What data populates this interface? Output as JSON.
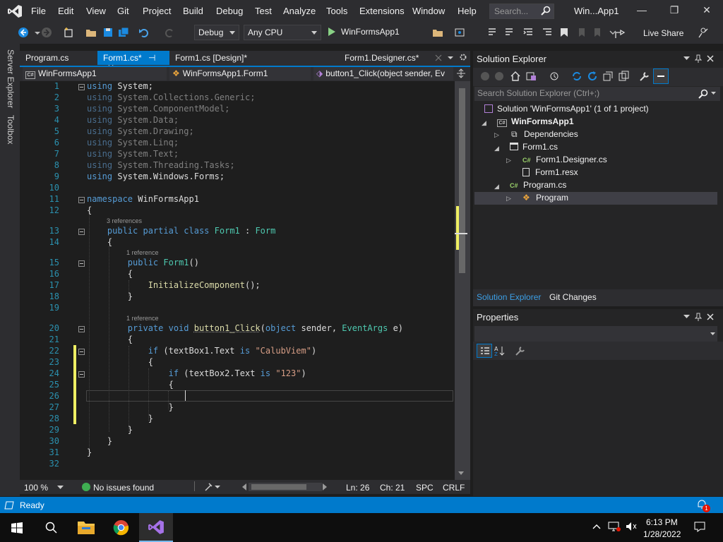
{
  "menubar": {
    "items": [
      "File",
      "Edit",
      "View",
      "Git",
      "Project",
      "Build",
      "Debug",
      "Test",
      "Analyze",
      "Tools",
      "Extensions",
      "Window",
      "Help"
    ],
    "search_placeholder": "Search...",
    "window_title": "Win...App1"
  },
  "toolbar": {
    "configuration": "Debug",
    "platform": "Any CPU",
    "run_target": "WinFormsApp1",
    "live_share": "Live Share"
  },
  "left_strip": {
    "server_explorer": "Server Explorer",
    "toolbox": "Toolbox"
  },
  "doc_tabs": [
    {
      "label": "Program.cs"
    },
    {
      "label": "Form1.cs*",
      "pin": "⊣",
      "close": "✕"
    },
    {
      "label": "Form1.cs [Design]*"
    },
    {
      "label": "Form1.Designer.cs*"
    }
  ],
  "navbar": {
    "project": "WinFormsApp1",
    "type": "WinFormsApp1.Form1",
    "member": "button1_Click(object sender, Ev"
  },
  "editor": {
    "line_numbers": [
      "1",
      "2",
      "3",
      "4",
      "5",
      "6",
      "7",
      "8",
      "9",
      "10",
      "11",
      "12",
      "13",
      "14",
      "15",
      "16",
      "17",
      "18",
      "19",
      "20",
      "21",
      "22",
      "23",
      "24",
      "25",
      "26",
      "27",
      "28",
      "29",
      "30",
      "31",
      "32"
    ],
    "codelens": {
      "class_refs": "3 references",
      "ctor_refs": "1 reference",
      "method_refs": "1 reference"
    },
    "usings": [
      "System",
      "System.Collections.Generic",
      "System.ComponentModel",
      "System.Data",
      "System.Drawing",
      "System.Linq",
      "System.Text",
      "System.Threading.Tasks",
      "System.Windows.Forms"
    ],
    "namespace": "WinFormsApp1",
    "class_name": "Form1",
    "base_class": "Form",
    "ctor_call": "InitializeComponent",
    "method_name": "button1_Click",
    "param_1_type": "object",
    "param_1_name": "sender",
    "param_2_type": "EventArgs",
    "param_2_name": "e",
    "cond_1_target": "textBox1.Text",
    "cond_1_value": "\"CalubViem\"",
    "cond_2_target": "textBox2.Text",
    "cond_2_value": "\"123\""
  },
  "editor_status": {
    "zoom": "100 %",
    "issues": "No issues found",
    "line": "Ln: 26",
    "col": "Ch: 21",
    "whitespace": "SPC",
    "line_ending": "CRLF"
  },
  "solution_explorer": {
    "title": "Solution Explorer",
    "search_placeholder": "Search Solution Explorer (Ctrl+;)",
    "tree": [
      {
        "label": "Solution 'WinFormsApp1' (1 of 1 project)"
      },
      {
        "label": "WinFormsApp1"
      },
      {
        "label": "Dependencies"
      },
      {
        "label": "Form1.cs"
      },
      {
        "label": "Form1.Designer.cs"
      },
      {
        "label": "Form1.resx"
      },
      {
        "label": "Program.cs"
      },
      {
        "label": "Program"
      }
    ],
    "tabs": [
      "Solution Explorer",
      "Git Changes"
    ]
  },
  "properties": {
    "title": "Properties"
  },
  "statusbar": {
    "text": "Ready",
    "notification_count": "1"
  },
  "taskbar": {
    "time": "6:13 PM",
    "date": "1/28/2022"
  },
  "colors": {
    "accent": "#007acc",
    "editor_bg": "#1e1e1e",
    "chrome_bg": "#2d2d30",
    "keyword": "#569cd6",
    "type": "#4ec9b0",
    "string": "#d69d85",
    "change_marker": "#efef63"
  }
}
